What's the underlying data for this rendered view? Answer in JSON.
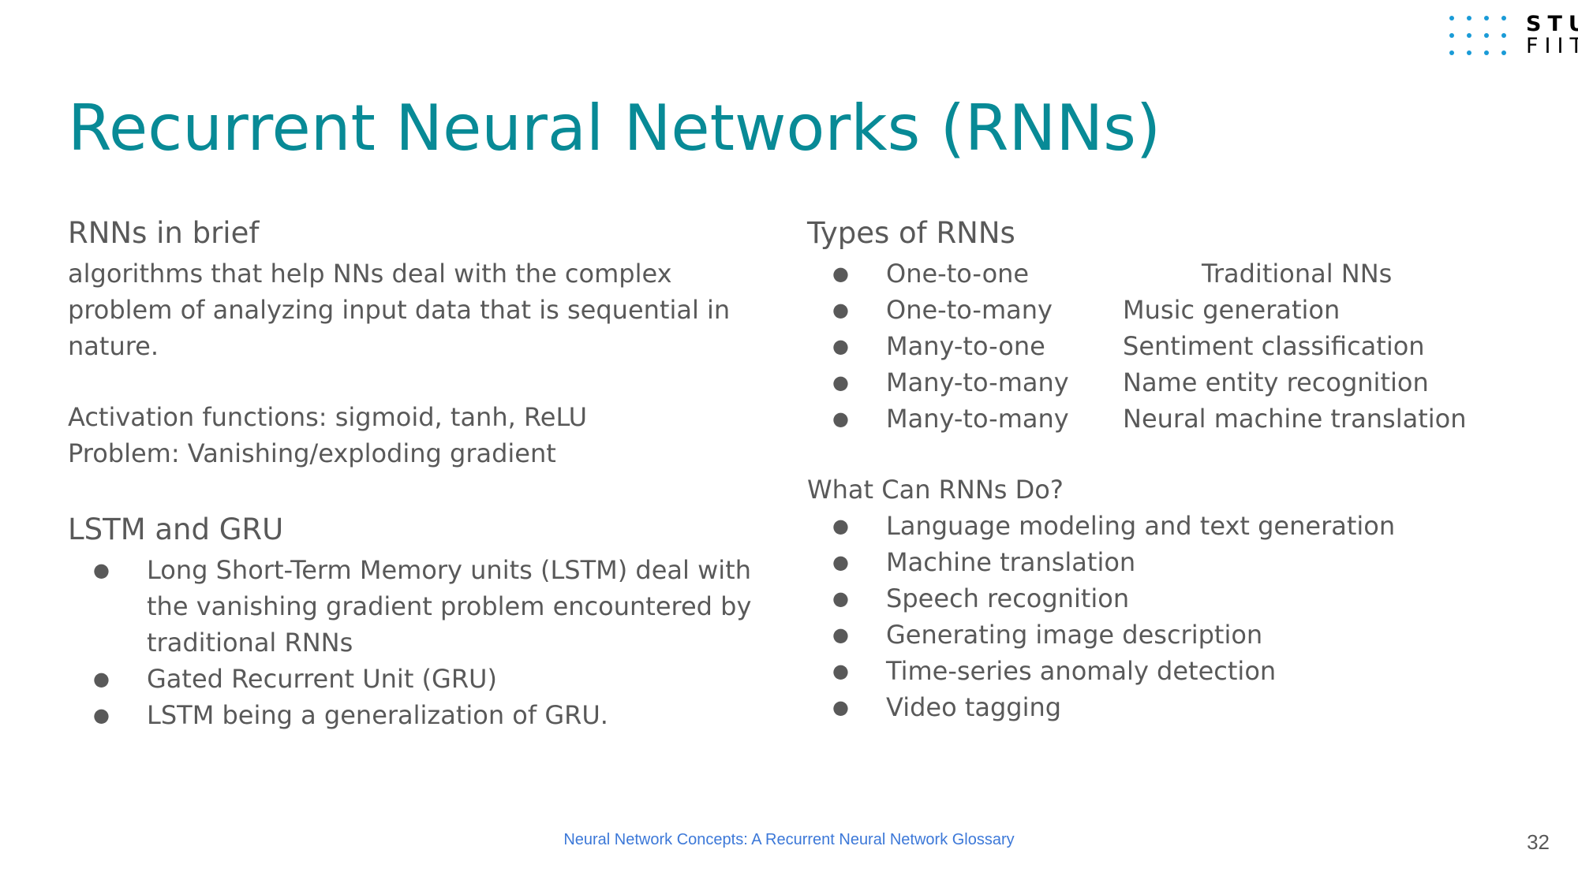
{
  "logo": {
    "line1": "STU",
    "line2": "FIIT",
    "dot_color": "#1a9bd7"
  },
  "title": "Recurrent Neural Networks (RNNs)",
  "left": {
    "brief_heading": "RNNs in brief",
    "brief_text": "algorithms that help NNs deal with the complex problem of analyzing input data that is sequential in nature.",
    "activation": "Activation functions: sigmoid, tanh, ReLU",
    "problem": "Problem: Vanishing/exploding gradient",
    "lstm_heading": "LSTM and GRU",
    "lstm_items": [
      "Long Short-Term Memory units (LSTM) deal with the vanishing gradient problem encountered by traditional RNNs",
      "Gated Recurrent Unit (GRU)",
      "LSTM being a generalization of GRU."
    ]
  },
  "right": {
    "types_heading": "Types of RNNs",
    "types": [
      {
        "type": "One-to-one",
        "use": "Traditional NNs"
      },
      {
        "type": "One-to-many",
        "use": "Music generation"
      },
      {
        "type": "Many-to-one",
        "use": "Sentiment classification"
      },
      {
        "type": "Many-to-many",
        "use": "Name entity recognition"
      },
      {
        "type": "Many-to-many",
        "use": "Neural machine translation"
      }
    ],
    "uses_heading": "What Can RNNs Do?",
    "uses": [
      "Language modeling and text generation",
      "Machine translation",
      "Speech recognition",
      "Generating image description",
      "Time-series anomaly detection",
      "Video tagging"
    ]
  },
  "footer": {
    "link_text": "Neural Network Concepts: A Recurrent Neural Network Glossary",
    "page_number": "32"
  },
  "colors": {
    "title": "#088a96",
    "body_text": "#595959",
    "link": "#3c78d8"
  },
  "bullet_glyph": "●"
}
